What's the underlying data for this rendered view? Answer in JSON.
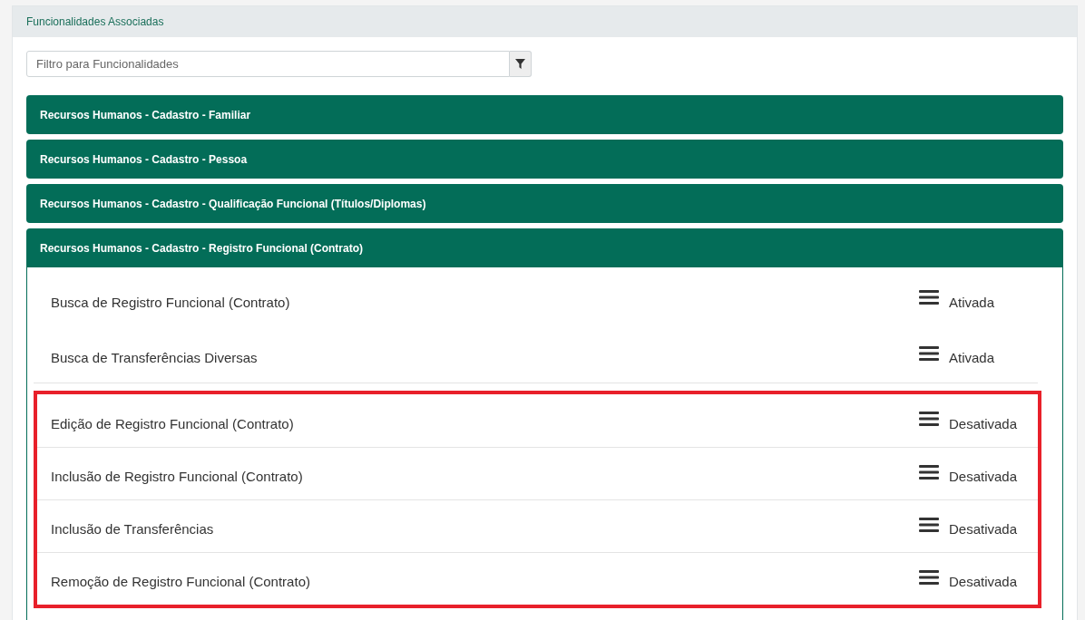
{
  "panel": {
    "title": "Funcionalidades Associadas"
  },
  "filter": {
    "placeholder": "Filtro para Funcionalidades"
  },
  "sections": [
    {
      "title": "Recursos Humanos - Cadastro - Familiar",
      "expanded": false
    },
    {
      "title": "Recursos Humanos - Cadastro - Pessoa",
      "expanded": false
    },
    {
      "title": "Recursos Humanos - Cadastro - Qualificação Funcional (Títulos/Diplomas)",
      "expanded": false
    },
    {
      "title": "Recursos Humanos - Cadastro - Registro Funcional (Contrato)",
      "expanded": true,
      "items": [
        {
          "name": "Busca de Registro Funcional (Contrato)",
          "status": "Ativada",
          "highlighted": false
        },
        {
          "name": "Busca de Transferências Diversas",
          "status": "Ativada",
          "highlighted": false
        },
        {
          "name": "Edição de Registro Funcional (Contrato)",
          "status": "Desativada",
          "highlighted": true
        },
        {
          "name": "Inclusão de Registro Funcional (Contrato)",
          "status": "Desativada",
          "highlighted": true
        },
        {
          "name": "Inclusão de Transferências",
          "status": "Desativada",
          "highlighted": true
        },
        {
          "name": "Remoção de Registro Funcional (Contrato)",
          "status": "Desativada",
          "highlighted": true
        }
      ]
    }
  ]
}
